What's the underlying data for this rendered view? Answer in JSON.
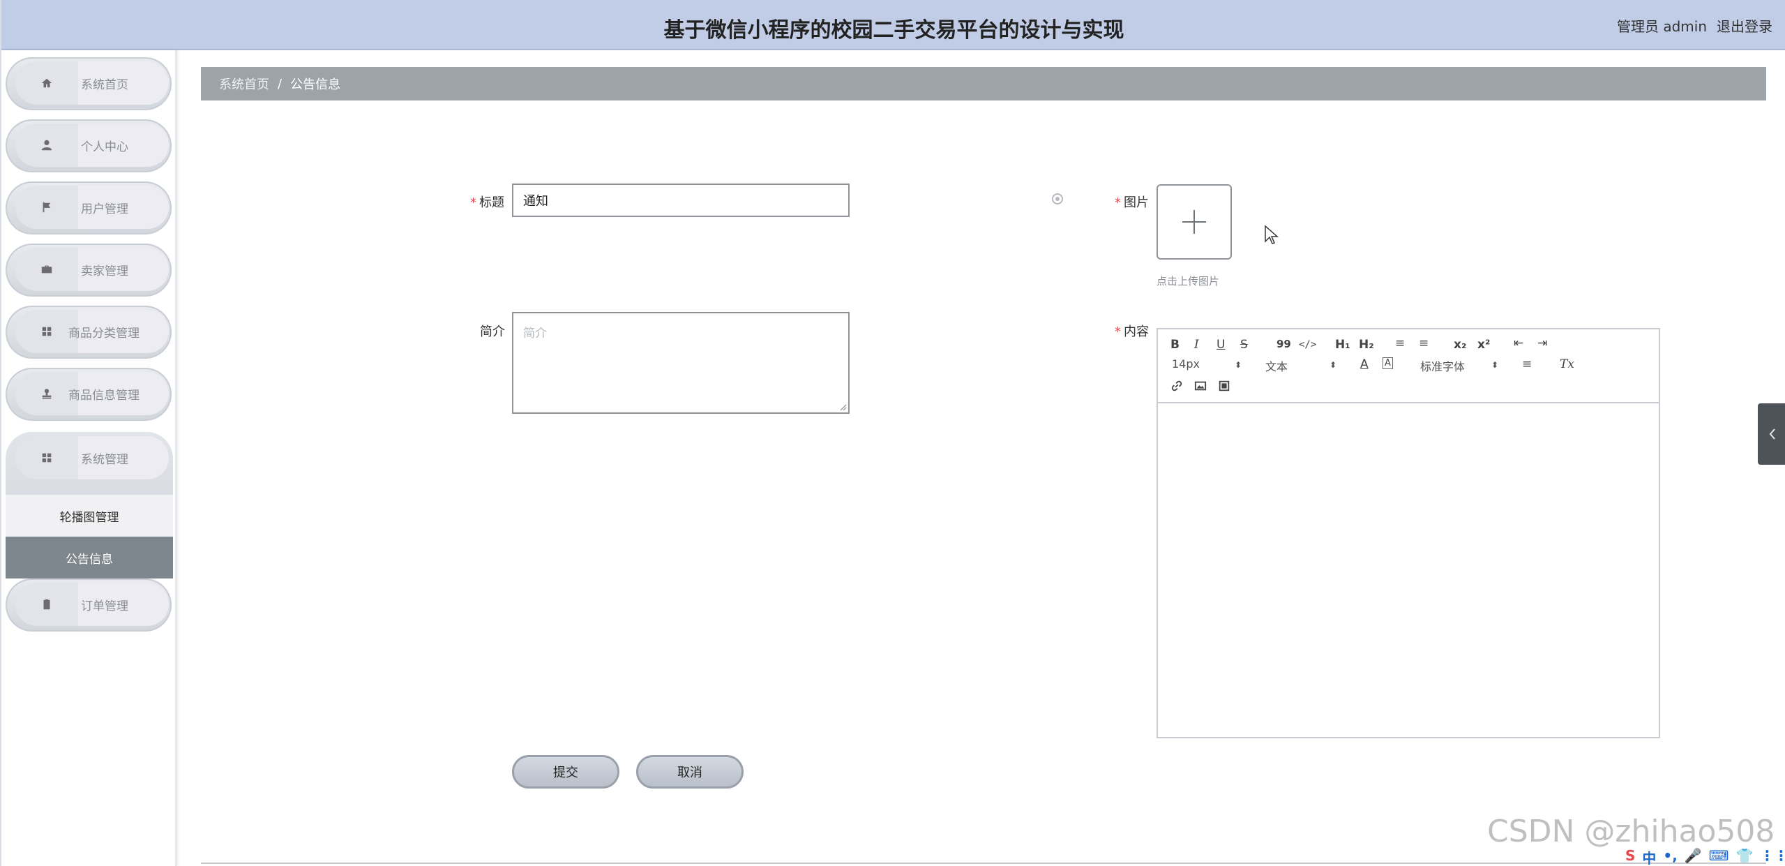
{
  "header": {
    "title": "基于微信小程序的校园二手交易平台的设计与实现",
    "user_label": "管理员 admin",
    "logout_label": "退出登录"
  },
  "sidebar": {
    "items": [
      {
        "label": "系统首页",
        "icon": "home-icon"
      },
      {
        "label": "个人中心",
        "icon": "user-icon"
      },
      {
        "label": "用户管理",
        "icon": "flag-icon"
      },
      {
        "label": "卖家管理",
        "icon": "briefcase-icon"
      },
      {
        "label": "商品分类管理",
        "icon": "grid-icon"
      },
      {
        "label": "商品信息管理",
        "icon": "stamp-icon"
      },
      {
        "label": "系统管理",
        "icon": "grid-icon"
      },
      {
        "label": "订单管理",
        "icon": "clipboard-icon"
      }
    ],
    "submenu": [
      {
        "label": "轮播图管理"
      },
      {
        "label": "公告信息"
      }
    ]
  },
  "breadcrumb": {
    "home": "系统首页",
    "separator": "/",
    "current": "公告信息"
  },
  "form": {
    "title_label": "标题",
    "title_value": "通知",
    "intro_label": "简介",
    "intro_placeholder": "简介",
    "image_label": "图片",
    "upload_hint": "点击上传图片",
    "content_label": "内容",
    "required_mark": "*"
  },
  "editor": {
    "toolbar": {
      "bold": "B",
      "italic": "I",
      "underline": "U",
      "strike": "S",
      "quote": "99",
      "code": "</>",
      "h1": "H₁",
      "h2": "H₂",
      "ordered_list": "≡",
      "bullet_list": "≡",
      "subscript": "x₂",
      "superscript": "x²",
      "outdent": "⇤",
      "indent": "⇥",
      "font_size": "14px",
      "text_style": "文本",
      "font_family": "标准字体",
      "clear_format": "Tx"
    }
  },
  "buttons": {
    "submit": "提交",
    "cancel": "取消"
  },
  "watermark": "CSDN @zhihao508",
  "tray": [
    "S",
    "中",
    "•,",
    "🎤",
    "⌨",
    "👕",
    "⋮⋮"
  ]
}
